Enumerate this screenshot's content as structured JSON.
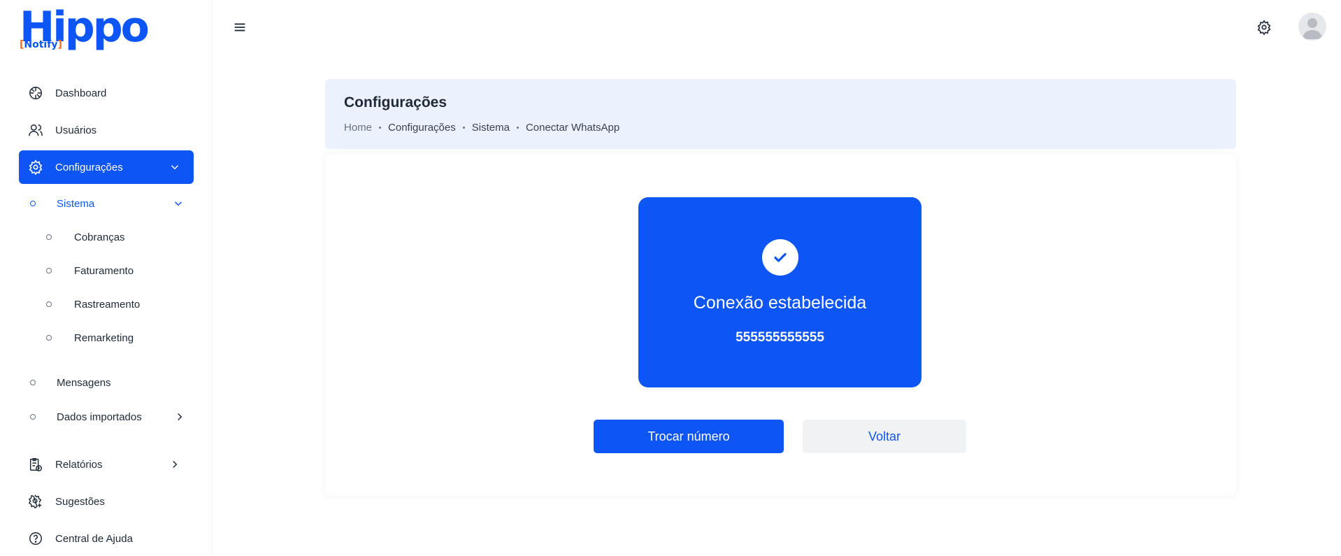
{
  "logo": {
    "main": "Hippo",
    "sub_open": "[",
    "sub_text": "Notify",
    "sub_close": "]"
  },
  "sidebar": {
    "items": [
      {
        "label": "Dashboard"
      },
      {
        "label": "Usuários"
      },
      {
        "label": "Configurações"
      },
      {
        "label": "Sistema"
      },
      {
        "label": "Cobranças"
      },
      {
        "label": "Faturamento"
      },
      {
        "label": "Rastreamento"
      },
      {
        "label": "Remarketing"
      },
      {
        "label": "Mensagens"
      },
      {
        "label": "Dados importados"
      },
      {
        "label": "Relatórios"
      },
      {
        "label": "Sugestões"
      },
      {
        "label": "Central de Ajuda"
      }
    ]
  },
  "header": {
    "title": "Configurações",
    "breadcrumb": [
      "Home",
      "Configurações",
      "Sistema",
      "Conectar WhatsApp"
    ]
  },
  "status": {
    "title": "Conexão estabelecida",
    "number": "555555555555"
  },
  "actions": {
    "primary": "Trocar número",
    "secondary": "Voltar"
  },
  "colors": {
    "accent": "#0d55f5",
    "logo_bracket": "#f4681f",
    "header_bg": "#ebf2fd"
  },
  "icons": [
    "menu-icon",
    "gear-icon",
    "user-avatar-icon",
    "dashboard-icon",
    "users-icon",
    "settings-icon",
    "chevron-down-icon",
    "chevron-right-icon",
    "report-icon",
    "suggestion-icon",
    "help-icon",
    "check-icon"
  ]
}
